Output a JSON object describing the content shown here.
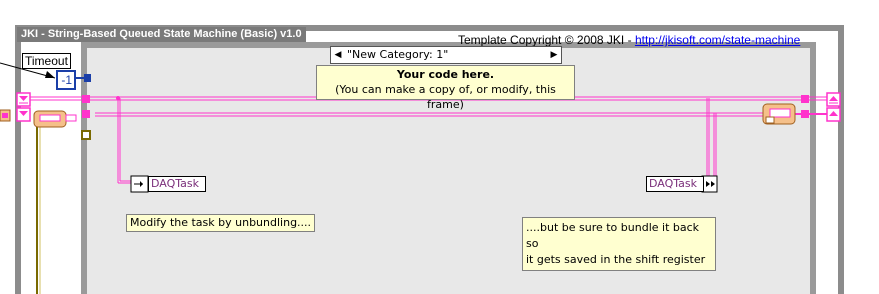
{
  "loop": {
    "title": "JKI - String-Based Queued State Machine (Basic) v1.0",
    "copyright_text": "Template Copyright © 2008 JKI - ",
    "copyright_link": "http://jkisoft.com/state-machine"
  },
  "timeout": {
    "label": "Timeout",
    "value": "-1"
  },
  "case_selector": {
    "value": "\"New Category: 1\"",
    "decrement_icon": "left-triangle-icon",
    "increment_icon": "right-triangle-icon"
  },
  "notes": {
    "main_title": "Your code here.",
    "main_subtitle": "(You can make a copy of, or modify, this frame)",
    "unbundle": "Modify the task by unbundling....",
    "bundle_line1": "....but be sure to bundle it back so",
    "bundle_line2": "it gets saved in the shift register"
  },
  "nodes": {
    "daq_left": "DAQTask",
    "daq_right": "DAQTask"
  },
  "colors": {
    "loop_frame": "#8c8c8c",
    "case_frame": "#9a9a9a",
    "case_background": "#e8e8e8",
    "wire_pink": "#ff33cc",
    "note_background": "#ffffd0",
    "numeric_blue": "#1b3fa8"
  }
}
